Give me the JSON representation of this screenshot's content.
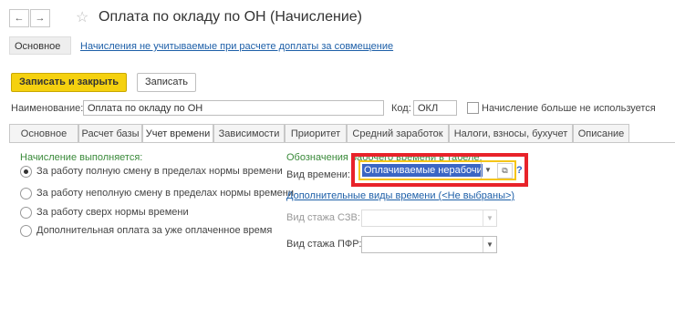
{
  "window": {
    "title": "Оплата по окладу по ОН (Начисление)",
    "back_glyph": "←",
    "forward_glyph": "→",
    "star_glyph": "☆"
  },
  "sections": {
    "main_label": "Основное",
    "link_label": "Начисления не учитываемые при расчете доплаты за совмещение"
  },
  "toolbar": {
    "save_close_label": "Записать и закрыть",
    "save_label": "Записать"
  },
  "form": {
    "name_label": "Наименование:",
    "name_value": "Оплата по окладу по ОН",
    "code_label": "Код:",
    "code_value": "ОКЛ",
    "unused_label": "Начисление больше не используется"
  },
  "tabs": [
    "Основное",
    "Расчет базы",
    "Учет времени",
    "Зависимости",
    "Приоритет",
    "Средний заработок",
    "Налоги, взносы, бухучет",
    "Описание"
  ],
  "time_tab": {
    "performed_title": "Начисление выполняется:",
    "options": [
      "За работу полную смену в пределах нормы времени",
      "За работу неполную смену в пределах нормы времени",
      "За работу сверх нормы времени",
      "Дополнительная оплата за уже оплаченное время"
    ],
    "designation_title": "Обозначения рабочего времени в табеле:",
    "time_type_label": "Вид времени:",
    "time_type_value": "Оплачиваемые нерабочие",
    "additional_link": "Дополнительные виды времени (<Не выбраны>)",
    "szv_label": "Вид стажа СЗВ:",
    "pfr_label": "Вид стажа ПФР:",
    "help_glyph": "?"
  },
  "colors": {
    "accent": "#f5d10f",
    "highlight": "#e8232a",
    "link": "#1d5fa8",
    "green": "#3a8a3a"
  }
}
